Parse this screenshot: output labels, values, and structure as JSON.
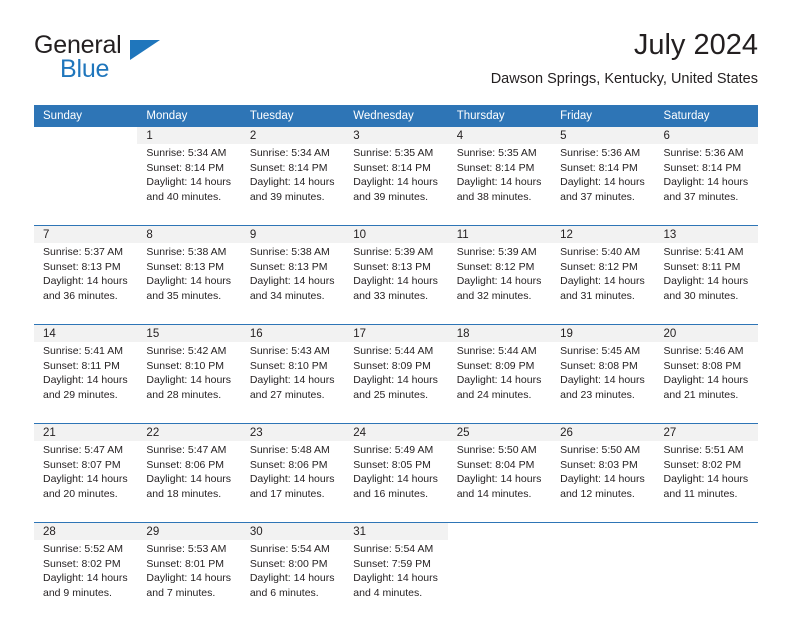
{
  "logo": {
    "word1": "General",
    "word2": "Blue",
    "triangle_color": "#1f76bc"
  },
  "header": {
    "title": "July 2024",
    "subtitle": "Dawson Springs, Kentucky, United States"
  },
  "theme": {
    "header_bg": "#2e75b6",
    "daynum_bg": "#f2f2f2",
    "separator": "#2e75b6",
    "text": "#231f20"
  },
  "weekdays": [
    "Sunday",
    "Monday",
    "Tuesday",
    "Wednesday",
    "Thursday",
    "Friday",
    "Saturday"
  ],
  "calendar": {
    "month": "July",
    "year": 2024,
    "weeks": [
      [
        {
          "day": "",
          "lines": []
        },
        {
          "day": "1",
          "lines": [
            "Sunrise: 5:34 AM",
            "Sunset: 8:14 PM",
            "Daylight: 14 hours",
            "and 40 minutes."
          ]
        },
        {
          "day": "2",
          "lines": [
            "Sunrise: 5:34 AM",
            "Sunset: 8:14 PM",
            "Daylight: 14 hours",
            "and 39 minutes."
          ]
        },
        {
          "day": "3",
          "lines": [
            "Sunrise: 5:35 AM",
            "Sunset: 8:14 PM",
            "Daylight: 14 hours",
            "and 39 minutes."
          ]
        },
        {
          "day": "4",
          "lines": [
            "Sunrise: 5:35 AM",
            "Sunset: 8:14 PM",
            "Daylight: 14 hours",
            "and 38 minutes."
          ]
        },
        {
          "day": "5",
          "lines": [
            "Sunrise: 5:36 AM",
            "Sunset: 8:14 PM",
            "Daylight: 14 hours",
            "and 37 minutes."
          ]
        },
        {
          "day": "6",
          "lines": [
            "Sunrise: 5:36 AM",
            "Sunset: 8:14 PM",
            "Daylight: 14 hours",
            "and 37 minutes."
          ]
        }
      ],
      [
        {
          "day": "7",
          "lines": [
            "Sunrise: 5:37 AM",
            "Sunset: 8:13 PM",
            "Daylight: 14 hours",
            "and 36 minutes."
          ]
        },
        {
          "day": "8",
          "lines": [
            "Sunrise: 5:38 AM",
            "Sunset: 8:13 PM",
            "Daylight: 14 hours",
            "and 35 minutes."
          ]
        },
        {
          "day": "9",
          "lines": [
            "Sunrise: 5:38 AM",
            "Sunset: 8:13 PM",
            "Daylight: 14 hours",
            "and 34 minutes."
          ]
        },
        {
          "day": "10",
          "lines": [
            "Sunrise: 5:39 AM",
            "Sunset: 8:13 PM",
            "Daylight: 14 hours",
            "and 33 minutes."
          ]
        },
        {
          "day": "11",
          "lines": [
            "Sunrise: 5:39 AM",
            "Sunset: 8:12 PM",
            "Daylight: 14 hours",
            "and 32 minutes."
          ]
        },
        {
          "day": "12",
          "lines": [
            "Sunrise: 5:40 AM",
            "Sunset: 8:12 PM",
            "Daylight: 14 hours",
            "and 31 minutes."
          ]
        },
        {
          "day": "13",
          "lines": [
            "Sunrise: 5:41 AM",
            "Sunset: 8:11 PM",
            "Daylight: 14 hours",
            "and 30 minutes."
          ]
        }
      ],
      [
        {
          "day": "14",
          "lines": [
            "Sunrise: 5:41 AM",
            "Sunset: 8:11 PM",
            "Daylight: 14 hours",
            "and 29 minutes."
          ]
        },
        {
          "day": "15",
          "lines": [
            "Sunrise: 5:42 AM",
            "Sunset: 8:10 PM",
            "Daylight: 14 hours",
            "and 28 minutes."
          ]
        },
        {
          "day": "16",
          "lines": [
            "Sunrise: 5:43 AM",
            "Sunset: 8:10 PM",
            "Daylight: 14 hours",
            "and 27 minutes."
          ]
        },
        {
          "day": "17",
          "lines": [
            "Sunrise: 5:44 AM",
            "Sunset: 8:09 PM",
            "Daylight: 14 hours",
            "and 25 minutes."
          ]
        },
        {
          "day": "18",
          "lines": [
            "Sunrise: 5:44 AM",
            "Sunset: 8:09 PM",
            "Daylight: 14 hours",
            "and 24 minutes."
          ]
        },
        {
          "day": "19",
          "lines": [
            "Sunrise: 5:45 AM",
            "Sunset: 8:08 PM",
            "Daylight: 14 hours",
            "and 23 minutes."
          ]
        },
        {
          "day": "20",
          "lines": [
            "Sunrise: 5:46 AM",
            "Sunset: 8:08 PM",
            "Daylight: 14 hours",
            "and 21 minutes."
          ]
        }
      ],
      [
        {
          "day": "21",
          "lines": [
            "Sunrise: 5:47 AM",
            "Sunset: 8:07 PM",
            "Daylight: 14 hours",
            "and 20 minutes."
          ]
        },
        {
          "day": "22",
          "lines": [
            "Sunrise: 5:47 AM",
            "Sunset: 8:06 PM",
            "Daylight: 14 hours",
            "and 18 minutes."
          ]
        },
        {
          "day": "23",
          "lines": [
            "Sunrise: 5:48 AM",
            "Sunset: 8:06 PM",
            "Daylight: 14 hours",
            "and 17 minutes."
          ]
        },
        {
          "day": "24",
          "lines": [
            "Sunrise: 5:49 AM",
            "Sunset: 8:05 PM",
            "Daylight: 14 hours",
            "and 16 minutes."
          ]
        },
        {
          "day": "25",
          "lines": [
            "Sunrise: 5:50 AM",
            "Sunset: 8:04 PM",
            "Daylight: 14 hours",
            "and 14 minutes."
          ]
        },
        {
          "day": "26",
          "lines": [
            "Sunrise: 5:50 AM",
            "Sunset: 8:03 PM",
            "Daylight: 14 hours",
            "and 12 minutes."
          ]
        },
        {
          "day": "27",
          "lines": [
            "Sunrise: 5:51 AM",
            "Sunset: 8:02 PM",
            "Daylight: 14 hours",
            "and 11 minutes."
          ]
        }
      ],
      [
        {
          "day": "28",
          "lines": [
            "Sunrise: 5:52 AM",
            "Sunset: 8:02 PM",
            "Daylight: 14 hours",
            "and 9 minutes."
          ]
        },
        {
          "day": "29",
          "lines": [
            "Sunrise: 5:53 AM",
            "Sunset: 8:01 PM",
            "Daylight: 14 hours",
            "and 7 minutes."
          ]
        },
        {
          "day": "30",
          "lines": [
            "Sunrise: 5:54 AM",
            "Sunset: 8:00 PM",
            "Daylight: 14 hours",
            "and 6 minutes."
          ]
        },
        {
          "day": "31",
          "lines": [
            "Sunrise: 5:54 AM",
            "Sunset: 7:59 PM",
            "Daylight: 14 hours",
            "and 4 minutes."
          ]
        },
        {
          "day": "",
          "lines": []
        },
        {
          "day": "",
          "lines": []
        },
        {
          "day": "",
          "lines": []
        }
      ]
    ]
  }
}
